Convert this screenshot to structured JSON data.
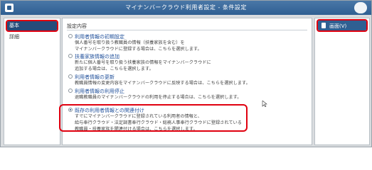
{
  "window": {
    "title": "マイナンバークラウド利用者設定 - 条件設定"
  },
  "left_nav": {
    "items": [
      {
        "label": "基本"
      },
      {
        "label": "詳細"
      }
    ]
  },
  "main": {
    "section_title": "設定内容",
    "options": [
      {
        "label": "利用者情報の初期設定",
        "selected": false,
        "desc": [
          "個人番号を取り扱う教職員の情報（扶養家族を含む）を",
          "マイナンバークラウドに登録する場合は、こちらを選択します。"
        ]
      },
      {
        "label": "扶養家族情報の追加",
        "selected": false,
        "desc": [
          "新たに個人番号を取り扱う扶養家族の情報をマイナンバークラウドに",
          "追加する場合は、こちらを選択します。"
        ]
      },
      {
        "label": "利用者情報の更新",
        "selected": false,
        "desc": [
          "教職員情報の変更内容をマイナンバークラウドに反映する場合は、こちらを選択します。"
        ]
      },
      {
        "label": "利用者情報の利用停止",
        "selected": false,
        "desc": [
          "退職教職員のマイナンバークラウドの利用を停止する場合は、こちらを選択します。"
        ]
      },
      {
        "label": "既存の利用者情報との関連付け",
        "selected": true,
        "desc": [
          "すでにマイナンバークラウドに登録されている利用者の情報と、",
          "給与奉行クラウド・法定調書奉行クラウド・総務人事奉行クラウドに登録されている",
          "教職員・扶養家族を関連付ける場合は、こちらを選択します。"
        ]
      }
    ]
  },
  "right": {
    "screen_button_label": "画面(V)"
  },
  "colors": {
    "titlebar": "#2f5f92",
    "nav_active": "#264c7a",
    "highlight": "#e0000f",
    "option_label": "#1f4f9a"
  },
  "icons": {
    "app": "app-logo-icon",
    "mascot": "mascot-icon",
    "radio": "radio-icon",
    "screen": "screen-icon",
    "cursor": "mouse-cursor-icon"
  }
}
